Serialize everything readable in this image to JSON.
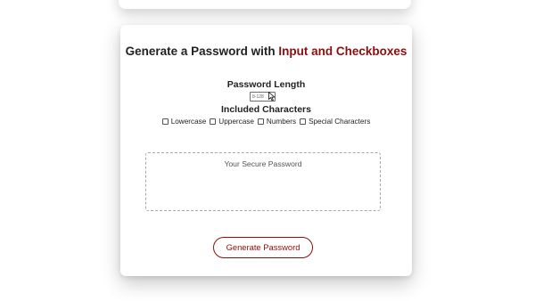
{
  "header": {
    "title_prefix": "Generate a Password with ",
    "title_accent": "Input and Checkboxes",
    "accent_color": "#8b0d0d"
  },
  "length": {
    "label": "Password Length",
    "placeholder": "8-128"
  },
  "characters": {
    "label": "Included Characters",
    "options": [
      {
        "label": "Lowercase",
        "checked": false
      },
      {
        "label": "Uppercase",
        "checked": false
      },
      {
        "label": "Numbers",
        "checked": false
      },
      {
        "label": "Special Characters",
        "checked": false
      }
    ]
  },
  "output": {
    "placeholder": "Your Secure Password"
  },
  "actions": {
    "generate_label": "Generate Password"
  },
  "icons": {
    "cursor": "mouse-pointer-icon"
  }
}
